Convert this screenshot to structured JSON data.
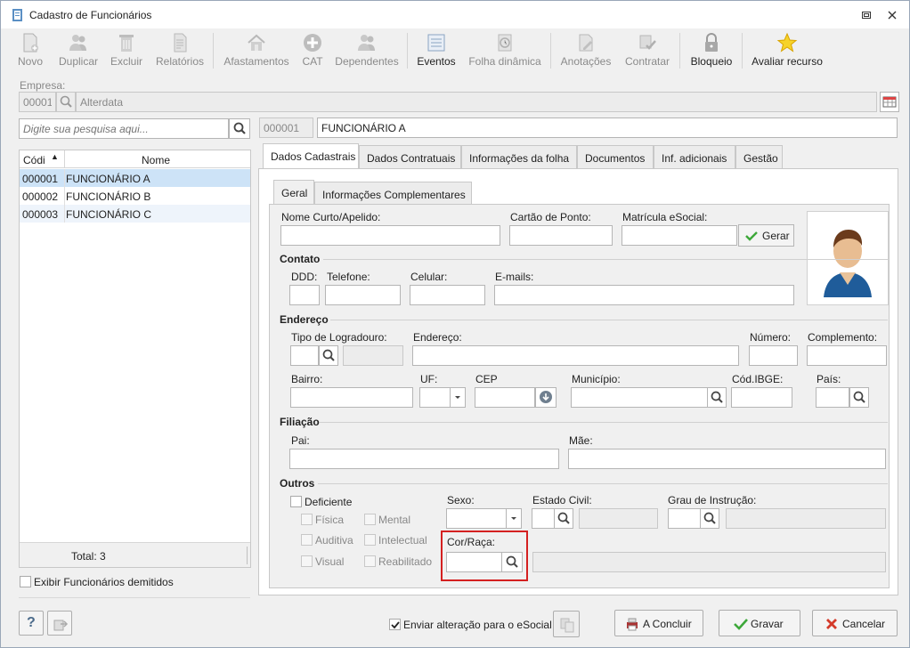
{
  "window": {
    "title": "Cadastro de Funcionários"
  },
  "toolbar": {
    "novo": "Novo",
    "duplicar": "Duplicar",
    "excluir": "Excluir",
    "relatorios": "Relatórios",
    "afastamentos": "Afastamentos",
    "cat": "CAT",
    "dependentes": "Dependentes",
    "eventos": "Eventos",
    "folha": "Folha dinâmica",
    "anotacoes": "Anotações",
    "contratar": "Contratar",
    "bloqueio": "Bloqueio",
    "avaliar": "Avaliar recurso"
  },
  "empresa": {
    "label": "Empresa:",
    "code": "00001",
    "name": "Alterdata"
  },
  "search": {
    "placeholder": "Digite sua pesquisa aqui..."
  },
  "employee": {
    "code": "000001",
    "name": "FUNCIONÁRIO A"
  },
  "list": {
    "col_code": "Códi",
    "col_name": "Nome",
    "rows": [
      {
        "code": "000001",
        "name": "FUNCIONÁRIO A"
      },
      {
        "code": "000002",
        "name": "FUNCIONÁRIO B"
      },
      {
        "code": "000003",
        "name": "FUNCIONÁRIO C"
      }
    ],
    "total": "Total: 3",
    "show_dismissed": "Exibir Funcionários demitidos"
  },
  "tabs": [
    "Dados Cadastrais",
    "Dados Contratuais",
    "Informações da folha",
    "Documentos",
    "Inf. adicionais",
    "Gestão"
  ],
  "subtabs": [
    "Geral",
    "Informações Complementares"
  ],
  "form": {
    "nome_curto": "Nome Curto/Apelido:",
    "cartao": "Cartão de Ponto:",
    "matricula": "Matrícula eSocial:",
    "gerar": "Gerar",
    "contato": "Contato",
    "ddd": "DDD:",
    "telefone": "Telefone:",
    "celular": "Celular:",
    "emails": "E-mails:",
    "endereco_sec": "Endereço",
    "tipo_log": "Tipo de Logradouro:",
    "endereco": "Endereço:",
    "numero": "Número:",
    "complemento": "Complemento:",
    "bairro": "Bairro:",
    "uf": "UF:",
    "cep": "CEP",
    "municipio": "Município:",
    "cod_ibge": "Cód.IBGE:",
    "pais": "País:",
    "filiacao": "Filiação",
    "pai": "Pai:",
    "mae": "Mãe:",
    "outros": "Outros",
    "deficiente": "Deficiente",
    "fisica": "Física",
    "mental": "Mental",
    "auditiva": "Auditiva",
    "intelectual": "Intelectual",
    "visual": "Visual",
    "reabilitado": "Reabilitado",
    "sexo": "Sexo:",
    "estado_civil": "Estado Civil:",
    "grau": "Grau de Instrução:",
    "cor_raca": "Cor/Raça:"
  },
  "footer": {
    "enviar": "Enviar alteração para o eSocial",
    "concluir": "A Concluir",
    "gravar": "Gravar",
    "cancelar": "Cancelar"
  },
  "colors": {
    "accent": "#3c7fb1",
    "highlight": "#d42020",
    "selected_row": "#cde3f7"
  }
}
